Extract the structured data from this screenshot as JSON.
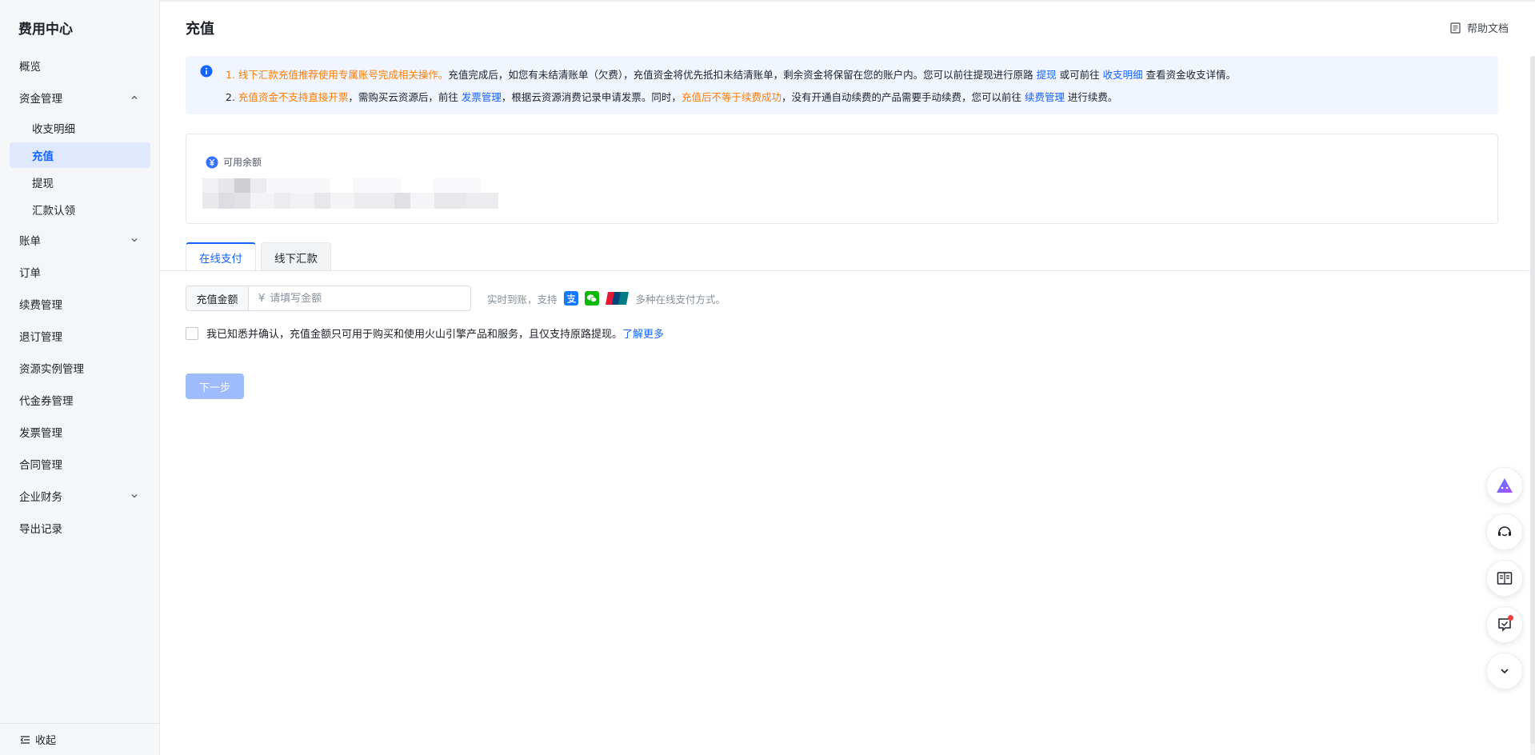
{
  "sidebar": {
    "title": "费用中心",
    "items": [
      {
        "label": "概览"
      },
      {
        "label": "资金管理"
      },
      {
        "label": "收支明细"
      },
      {
        "label": "充值"
      },
      {
        "label": "提现"
      },
      {
        "label": "汇款认领"
      },
      {
        "label": "账单"
      },
      {
        "label": "订单"
      },
      {
        "label": "续费管理"
      },
      {
        "label": "退订管理"
      },
      {
        "label": "资源实例管理"
      },
      {
        "label": "代金券管理"
      },
      {
        "label": "发票管理"
      },
      {
        "label": "合同管理"
      },
      {
        "label": "企业财务"
      },
      {
        "label": "导出记录"
      }
    ],
    "collapse_label": "收起"
  },
  "header": {
    "title": "充值",
    "help_label": "帮助文档"
  },
  "notice": {
    "line1": {
      "prefix": "1. ",
      "highlight": "线下汇款充值推荐使用专属账号完成相关操作。",
      "text_a": "充值完成后，如您有未结清账单（欠费），充值资金将优先抵扣未结清账单，剩余资金将保留在您的账户内。您可以前往提现进行原路 ",
      "link_a": "提现",
      "text_b": " 或可前往 ",
      "link_b": "收支明细",
      "text_c": " 查看资金收支详情。"
    },
    "line2": {
      "prefix": "2. ",
      "highlight_a": "充值资金不支持直接开票",
      "text_a": "，需购买云资源后，前往 ",
      "link_a": "发票管理",
      "text_b": "，根据云资源消费记录申请发票。同时，",
      "highlight_b": "充值后不等于续费成功",
      "text_c": "，没有开通自动续费的产品需要手动续费，您可以前往 ",
      "link_b": "续费管理",
      "text_d": " 进行续费。"
    }
  },
  "balance": {
    "label": "可用余额"
  },
  "tabs": [
    {
      "label": "在线支付"
    },
    {
      "label": "线下汇款"
    }
  ],
  "form": {
    "amount_label": "充值金额",
    "currency_symbol": "¥",
    "amount_value": "",
    "amount_placeholder": "请填写金额",
    "pay_hint_prefix": "实时到账，支持",
    "pay_hint_suffix": "多种在线支付方式。",
    "agree_text": "我已知悉并确认，充值金额只可用于购买和使用火山引擎产品和服务，且仅支持原路提现。",
    "agree_link": "了解更多",
    "next_label": "下一步"
  },
  "colors": {
    "primary": "#1664ff",
    "warning": "#ff7d00",
    "notice_bg": "#f0f5ff",
    "active_nav_bg": "#e0e8fd",
    "disabled_btn": "#9ebcfb"
  },
  "icons": {
    "notice": "info-icon",
    "help": "document-icon",
    "balance": "yuan-icon",
    "payments": [
      "alipay-icon",
      "wechat-pay-icon",
      "unionpay-icon"
    ],
    "float_tools": [
      "ai-assistant-icon",
      "customer-service-icon",
      "manual-book-icon",
      "feedback-icon",
      "collapse-down-icon"
    ],
    "collapse": "collapse-menu-icon"
  }
}
